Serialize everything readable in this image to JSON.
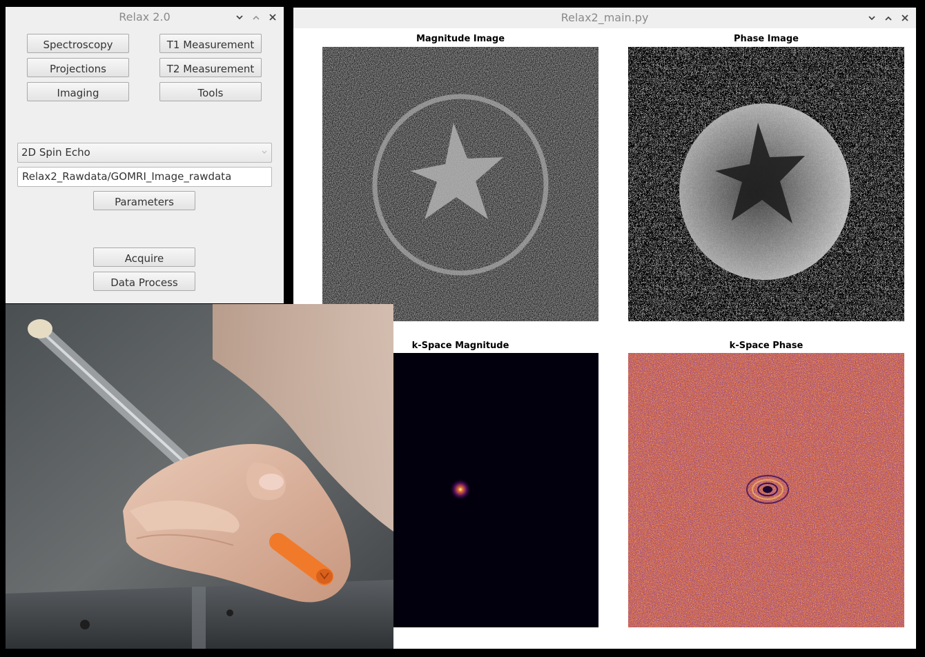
{
  "relax_window": {
    "title": "Relax 2.0",
    "buttons": {
      "spectroscopy": "Spectroscopy",
      "t1": "T1 Measurement",
      "projections": "Projections",
      "t2": "T2 Measurement",
      "imaging": "Imaging",
      "tools": "Tools",
      "parameters": "Parameters",
      "acquire": "Acquire",
      "data_process": "Data Process"
    },
    "sequence_select": {
      "selected": "2D Spin Echo"
    },
    "datapath_input": {
      "value": "Relax2_Rawdata/GOMRI_Image_rawdata"
    }
  },
  "main_window": {
    "title": "Relax2_main.py",
    "plots": {
      "magnitude": "Magnitude Image",
      "phase": "Phase Image",
      "kspace_magnitude": "k-Space Magnitude",
      "kspace_phase": "k-Space Phase"
    }
  },
  "colors": {
    "window_bg": "#efefef",
    "title_text": "#8a8a8a",
    "kspace_phase_orange": "#d86a44",
    "kspace_phase_purple": "#3a0f5c",
    "kspace_dark": "#02000c"
  }
}
